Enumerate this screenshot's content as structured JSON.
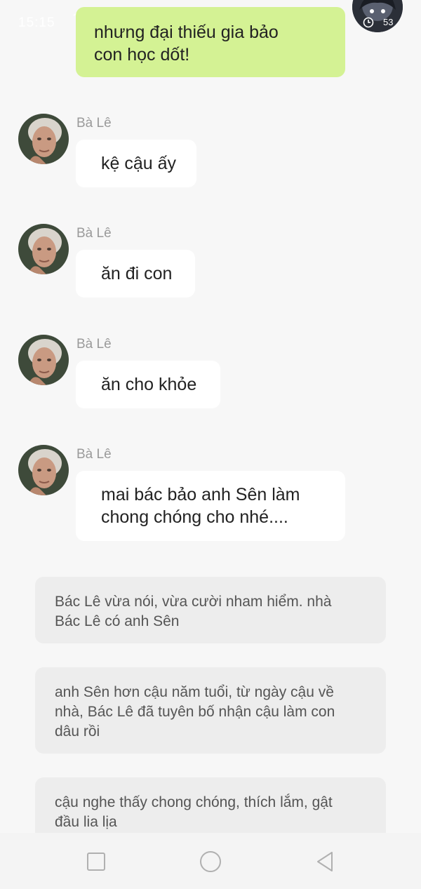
{
  "status_bar": {
    "time": "15:15",
    "battery": "53",
    "wifi_icon": "wifi-icon",
    "alarm_icon": "alarm-icon"
  },
  "outgoing_message": {
    "lines": [
      "nhưng đại thiếu gia bảo",
      "con học dốt!"
    ]
  },
  "incoming_messages": [
    {
      "sender": "Bà Lê",
      "lines": [
        "kệ cậu ấy"
      ]
    },
    {
      "sender": "Bà Lê",
      "lines": [
        "ăn đi con"
      ]
    },
    {
      "sender": "Bà Lê",
      "lines": [
        "ăn cho khỏe"
      ]
    },
    {
      "sender": "Bà Lê",
      "lines": [
        "mai bác bảo anh Sên làm",
        "chong chóng cho nhé...."
      ]
    }
  ],
  "narrations": [
    {
      "lines": [
        "Bác Lê vừa nói, vừa cười nham hiểm. nhà",
        "Bác Lê có anh Sên"
      ]
    },
    {
      "lines": [
        "anh Sên hơn cậu năm tuổi, từ ngày cậu về",
        "nhà, Bác Lê đã tuyên bố nhận cậu làm con",
        "dâu rồi"
      ]
    },
    {
      "lines": [
        "cậu nghe thấy chong chóng, thích lắm, gật",
        "đầu lia lịa"
      ]
    }
  ],
  "nav": {
    "recent_icon": "square-icon",
    "home_icon": "circle-home-icon",
    "back_icon": "triangle-back-icon"
  },
  "colors": {
    "background": "#f7f7f7",
    "outgoing_bubble": "#d4f294",
    "incoming_bubble": "#ffffff",
    "narration_box": "#ededed",
    "sender_name": "#9a9a9a"
  }
}
